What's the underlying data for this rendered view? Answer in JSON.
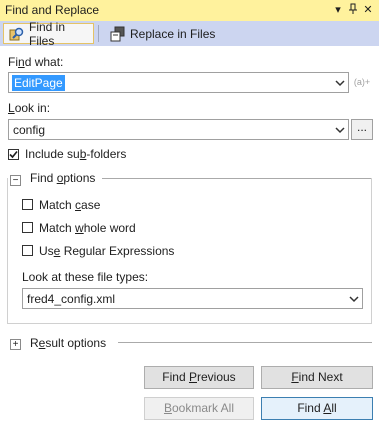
{
  "window": {
    "title": "Find and Replace"
  },
  "tabs": [
    {
      "label_pre": "Find in Files",
      "icon": "find-in-files-icon",
      "active": true
    },
    {
      "label_pre": "Replace in Files",
      "icon": "replace-in-files-icon",
      "active": false
    }
  ],
  "find_what": {
    "label_a": "Fi",
    "label_u": "n",
    "label_b": "d what:",
    "value": "EditPage",
    "regex_badge": "(a)+"
  },
  "look_in": {
    "label_u": "L",
    "label_b": "ook in:",
    "value": "config",
    "browse_label": "..."
  },
  "include_subfolders": {
    "label_a": "Include su",
    "label_u": "b",
    "label_b": "-folders",
    "checked": true
  },
  "find_options": {
    "expander": "−",
    "label_a": "Find ",
    "label_u": "o",
    "label_b": "ptions",
    "match_case": {
      "label_a": "Match ",
      "label_u": "c",
      "label_b": "ase",
      "checked": false
    },
    "match_whole_word": {
      "label_a": "Match ",
      "label_u": "w",
      "label_b": "hole word",
      "checked": false
    },
    "use_regex": {
      "label_a": "Us",
      "label_u": "e",
      "label_b": " Regular Expressions",
      "checked": false
    },
    "file_types_label": "Look at these file types:",
    "file_types_value": "fred4_config.xml"
  },
  "result_options": {
    "expander": "+",
    "label_a": "R",
    "label_u": "e",
    "label_b": "sult options"
  },
  "buttons": {
    "find_previous": {
      "label_a": "Find ",
      "label_u": "P",
      "label_b": "revious"
    },
    "find_next": {
      "label_a": "",
      "label_u": "F",
      "label_b": "ind Next"
    },
    "bookmark_all": {
      "label_a": "",
      "label_u": "B",
      "label_b": "ookmark All"
    },
    "find_all": {
      "label_a": "Find ",
      "label_u": "A",
      "label_b": "ll"
    }
  },
  "colors": {
    "titlebar": "#fff29d",
    "tabbar": "#ccd5f0",
    "selection": "#3399ff"
  }
}
